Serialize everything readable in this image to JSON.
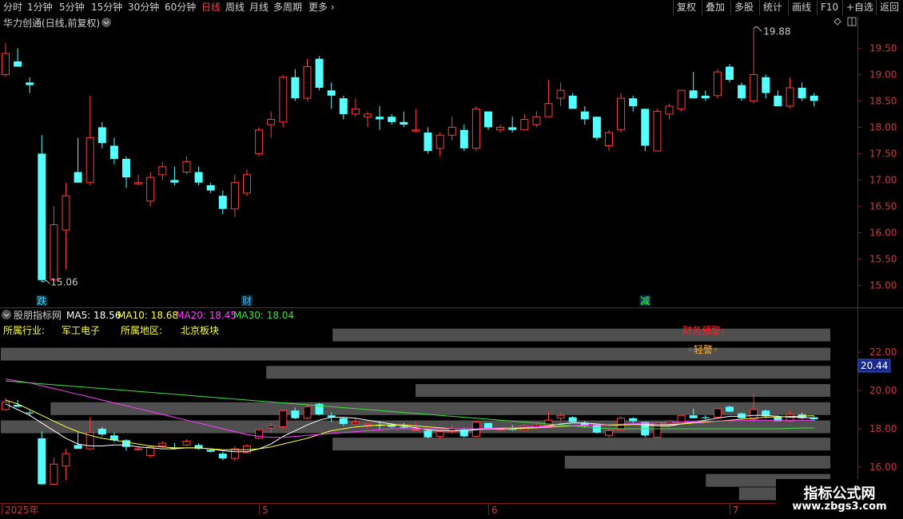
{
  "toolbar": {
    "left": [
      {
        "label": "分时",
        "active": false
      },
      {
        "label": "1分钟",
        "active": false
      },
      {
        "label": "5分钟",
        "active": false
      },
      {
        "label": "15分钟",
        "active": false
      },
      {
        "label": "30分钟",
        "active": false
      },
      {
        "label": "60分钟",
        "active": false
      },
      {
        "label": "日线",
        "active": true
      },
      {
        "label": "周线",
        "active": false
      },
      {
        "label": "月线",
        "active": false
      },
      {
        "label": "多周期",
        "active": false
      },
      {
        "label": "更多",
        "active": false
      }
    ],
    "right": [
      "复权",
      "叠加",
      "多股",
      "统计",
      "画线",
      "F10",
      "+自选",
      "返回"
    ]
  },
  "main_header": {
    "title": "华力创通(日线,前复权)"
  },
  "indicator_header": {
    "name": "股朋指标网",
    "ma5": "MA5: 18.56",
    "ma10": "MA10: 18.68",
    "ma20": "MA20: 18.45",
    "ma30": "MA30: 18.04"
  },
  "info": {
    "industry_label": "所属行业:",
    "industry": "军工电子",
    "region_label": "所属地区:",
    "region": "北京板块",
    "warning_title": "财务预警:",
    "warning_level": "◦轻警◦"
  },
  "markers": [
    {
      "text": "跌",
      "index": 3,
      "color": "#40e0ff"
    },
    {
      "text": "财",
      "index": 20,
      "color": "#40b0ff"
    },
    {
      "text": "减",
      "index": 53,
      "color": "#40ff60"
    }
  ],
  "date_labels": [
    {
      "text": "2025年",
      "index": 0
    },
    {
      "text": "5",
      "index": 21
    },
    {
      "text": "6",
      "index": 40
    },
    {
      "text": "7",
      "index": 60
    }
  ],
  "price_tag": "20.44",
  "watermark": {
    "line1": "指标公式网",
    "line2": "www.zbgs3.com"
  },
  "chart_data": {
    "type": "candlestick",
    "main_axis": {
      "ylim": [
        14.9,
        19.9
      ],
      "ticks": [
        "19.50",
        "19.00",
        "18.50",
        "18.00",
        "17.50",
        "17.00",
        "16.50",
        "16.00",
        "15.50",
        "15.00"
      ]
    },
    "sub_axis": {
      "ylim": [
        14.2,
        23.8
      ],
      "ticks": [
        "22.00",
        "20.00",
        "18.00",
        "16.00"
      ]
    },
    "max_label": "19.88",
    "min_label": "15.06",
    "candles": [
      {
        "o": 19.0,
        "h": 19.6,
        "l": 18.95,
        "c": 19.4
      },
      {
        "o": 19.25,
        "h": 19.5,
        "l": 19.15,
        "c": 19.15
      },
      {
        "o": 18.85,
        "h": 18.95,
        "l": 18.65,
        "c": 18.8
      },
      {
        "o": 17.5,
        "h": 17.85,
        "l": 15.06,
        "c": 15.1
      },
      {
        "o": 15.1,
        "h": 16.5,
        "l": 15.06,
        "c": 16.15
      },
      {
        "o": 16.05,
        "h": 16.95,
        "l": 15.3,
        "c": 16.7
      },
      {
        "o": 17.15,
        "h": 17.8,
        "l": 16.95,
        "c": 16.95
      },
      {
        "o": 16.95,
        "h": 18.6,
        "l": 16.9,
        "c": 17.8
      },
      {
        "o": 18.0,
        "h": 18.1,
        "l": 17.6,
        "c": 17.7
      },
      {
        "o": 17.65,
        "h": 17.8,
        "l": 17.3,
        "c": 17.4
      },
      {
        "o": 17.4,
        "h": 17.45,
        "l": 16.85,
        "c": 17.05
      },
      {
        "o": 16.95,
        "h": 17.1,
        "l": 16.9,
        "c": 16.95
      },
      {
        "o": 16.6,
        "h": 17.15,
        "l": 16.5,
        "c": 17.05
      },
      {
        "o": 17.1,
        "h": 17.35,
        "l": 17.0,
        "c": 17.25
      },
      {
        "o": 17.0,
        "h": 17.25,
        "l": 16.9,
        "c": 16.95
      },
      {
        "o": 17.15,
        "h": 17.45,
        "l": 17.1,
        "c": 17.35
      },
      {
        "o": 17.15,
        "h": 17.25,
        "l": 16.9,
        "c": 16.95
      },
      {
        "o": 16.9,
        "h": 16.95,
        "l": 16.75,
        "c": 16.8
      },
      {
        "o": 16.7,
        "h": 16.8,
        "l": 16.35,
        "c": 16.45
      },
      {
        "o": 16.45,
        "h": 17.1,
        "l": 16.3,
        "c": 16.95
      },
      {
        "o": 16.75,
        "h": 17.2,
        "l": 16.7,
        "c": 17.1
      },
      {
        "o": 17.5,
        "h": 18.0,
        "l": 17.45,
        "c": 17.95
      },
      {
        "o": 18.05,
        "h": 18.3,
        "l": 17.8,
        "c": 18.15
      },
      {
        "o": 18.1,
        "h": 19.0,
        "l": 18.0,
        "c": 18.95
      },
      {
        "o": 18.95,
        "h": 19.1,
        "l": 18.5,
        "c": 18.55
      },
      {
        "o": 18.55,
        "h": 19.3,
        "l": 18.5,
        "c": 19.15
      },
      {
        "o": 19.3,
        "h": 19.35,
        "l": 18.7,
        "c": 18.75
      },
      {
        "o": 18.7,
        "h": 18.85,
        "l": 18.35,
        "c": 18.6
      },
      {
        "o": 18.55,
        "h": 18.6,
        "l": 18.15,
        "c": 18.25
      },
      {
        "o": 18.25,
        "h": 18.55,
        "l": 18.2,
        "c": 18.35
      },
      {
        "o": 18.2,
        "h": 18.3,
        "l": 18.0,
        "c": 18.25
      },
      {
        "o": 18.2,
        "h": 18.4,
        "l": 17.95,
        "c": 18.15
      },
      {
        "o": 18.2,
        "h": 18.25,
        "l": 18.05,
        "c": 18.1
      },
      {
        "o": 18.1,
        "h": 18.3,
        "l": 18.0,
        "c": 18.05
      },
      {
        "o": 17.95,
        "h": 18.35,
        "l": 17.9,
        "c": 17.95
      },
      {
        "o": 17.9,
        "h": 18.0,
        "l": 17.5,
        "c": 17.55
      },
      {
        "o": 17.6,
        "h": 17.9,
        "l": 17.45,
        "c": 17.85
      },
      {
        "o": 17.85,
        "h": 18.2,
        "l": 17.75,
        "c": 18.0
      },
      {
        "o": 17.95,
        "h": 18.05,
        "l": 17.55,
        "c": 17.6
      },
      {
        "o": 17.6,
        "h": 18.4,
        "l": 17.55,
        "c": 18.35
      },
      {
        "o": 18.3,
        "h": 18.3,
        "l": 17.95,
        "c": 18.0
      },
      {
        "o": 17.95,
        "h": 18.05,
        "l": 17.9,
        "c": 18.0
      },
      {
        "o": 18.0,
        "h": 18.2,
        "l": 17.9,
        "c": 17.95
      },
      {
        "o": 17.95,
        "h": 18.25,
        "l": 17.95,
        "c": 18.15
      },
      {
        "o": 18.05,
        "h": 18.3,
        "l": 18.0,
        "c": 18.2
      },
      {
        "o": 18.2,
        "h": 18.9,
        "l": 18.2,
        "c": 18.45
      },
      {
        "o": 18.55,
        "h": 18.85,
        "l": 18.4,
        "c": 18.7
      },
      {
        "o": 18.6,
        "h": 18.65,
        "l": 18.35,
        "c": 18.35
      },
      {
        "o": 18.3,
        "h": 18.4,
        "l": 18.05,
        "c": 18.15
      },
      {
        "o": 18.2,
        "h": 18.2,
        "l": 17.75,
        "c": 17.8
      },
      {
        "o": 17.65,
        "h": 17.95,
        "l": 17.55,
        "c": 17.9
      },
      {
        "o": 17.95,
        "h": 18.65,
        "l": 17.9,
        "c": 18.55
      },
      {
        "o": 18.55,
        "h": 18.6,
        "l": 18.3,
        "c": 18.4
      },
      {
        "o": 18.35,
        "h": 18.35,
        "l": 17.55,
        "c": 17.65
      },
      {
        "o": 17.55,
        "h": 18.35,
        "l": 17.55,
        "c": 18.3
      },
      {
        "o": 18.25,
        "h": 18.45,
        "l": 18.15,
        "c": 18.4
      },
      {
        "o": 18.35,
        "h": 18.7,
        "l": 18.3,
        "c": 18.7
      },
      {
        "o": 18.7,
        "h": 19.05,
        "l": 18.55,
        "c": 18.55
      },
      {
        "o": 18.6,
        "h": 18.7,
        "l": 18.5,
        "c": 18.55
      },
      {
        "o": 18.6,
        "h": 19.1,
        "l": 18.55,
        "c": 19.05
      },
      {
        "o": 19.15,
        "h": 19.2,
        "l": 18.85,
        "c": 18.9
      },
      {
        "o": 18.8,
        "h": 18.85,
        "l": 18.5,
        "c": 18.55
      },
      {
        "o": 18.5,
        "h": 19.88,
        "l": 18.45,
        "c": 19.0
      },
      {
        "o": 18.95,
        "h": 19.0,
        "l": 18.55,
        "c": 18.65
      },
      {
        "o": 18.6,
        "h": 18.7,
        "l": 18.4,
        "c": 18.4
      },
      {
        "o": 18.4,
        "h": 18.95,
        "l": 18.35,
        "c": 18.75
      },
      {
        "o": 18.75,
        "h": 18.85,
        "l": 18.5,
        "c": 18.55
      },
      {
        "o": 18.6,
        "h": 18.65,
        "l": 18.4,
        "c": 18.5
      }
    ],
    "sub_ma": {
      "white": [
        19.3,
        19.0,
        18.7,
        18.3,
        17.9,
        17.5,
        17.2,
        17.1,
        17.1,
        17.15,
        17.15,
        17.05,
        17.0,
        16.95,
        16.95,
        17.0,
        17.0,
        16.95,
        16.85,
        16.8,
        16.8,
        16.95,
        17.2,
        17.6,
        17.9,
        18.2,
        18.45,
        18.6,
        18.6,
        18.55,
        18.45,
        18.35,
        18.25,
        18.15,
        18.05,
        17.95,
        17.9,
        17.9,
        17.9,
        17.95,
        18.0,
        18.0,
        18.0,
        18.05,
        18.1,
        18.15,
        18.25,
        18.3,
        18.3,
        18.25,
        18.2,
        18.2,
        18.25,
        18.2,
        18.15,
        18.15,
        18.25,
        18.35,
        18.45,
        18.55,
        18.65,
        18.65,
        18.7,
        18.7,
        18.65,
        18.6,
        18.6,
        18.55
      ],
      "yellow": [
        19.5,
        19.3,
        19.0,
        18.7,
        18.4,
        18.1,
        17.85,
        17.65,
        17.5,
        17.4,
        17.3,
        17.2,
        17.1,
        17.05,
        17.0,
        17.0,
        17.0,
        16.95,
        16.9,
        16.9,
        16.9,
        16.95,
        17.05,
        17.2,
        17.35,
        17.5,
        17.7,
        17.9,
        18.0,
        18.1,
        18.15,
        18.2,
        18.2,
        18.2,
        18.15,
        18.1,
        18.05,
        18.0,
        18.0,
        17.98,
        17.98,
        17.98,
        18.0,
        18.02,
        18.05,
        18.08,
        18.12,
        18.15,
        18.18,
        18.2,
        18.2,
        18.2,
        18.22,
        18.22,
        18.22,
        18.22,
        18.25,
        18.3,
        18.35,
        18.4,
        18.45,
        18.5,
        18.55,
        18.6,
        18.62,
        18.64,
        18.66,
        18.68
      ],
      "magenta": [
        20.6,
        20.5,
        20.4,
        20.25,
        20.1,
        19.95,
        19.8,
        19.65,
        19.5,
        19.35,
        19.2,
        19.05,
        18.9,
        18.75,
        18.6,
        18.45,
        18.3,
        18.15,
        18.0,
        17.85,
        17.7,
        17.6,
        17.55,
        17.55,
        17.6,
        17.65,
        17.7,
        17.75,
        17.8,
        17.85,
        17.9,
        17.95,
        18.0,
        18.0,
        18.0,
        18.0,
        18.0,
        18.0,
        18.0,
        18.0,
        18.02,
        18.04,
        18.06,
        18.08,
        18.1,
        18.12,
        18.14,
        18.16,
        18.18,
        18.2,
        18.22,
        18.24,
        18.26,
        18.28,
        18.3,
        18.32,
        18.34,
        18.36,
        18.38,
        18.4,
        18.42,
        18.43,
        18.44,
        18.45,
        18.45,
        18.45,
        18.45,
        18.45
      ],
      "green": [
        20.5,
        20.45,
        20.4,
        20.35,
        20.3,
        20.25,
        20.2,
        20.15,
        20.1,
        20.05,
        20.0,
        19.95,
        19.9,
        19.85,
        19.8,
        19.75,
        19.7,
        19.65,
        19.6,
        19.55,
        19.5,
        19.45,
        19.4,
        19.35,
        19.3,
        19.25,
        19.2,
        19.15,
        19.1,
        19.05,
        19.0,
        18.95,
        18.9,
        18.85,
        18.8,
        18.75,
        18.7,
        18.65,
        18.6,
        18.55,
        18.5,
        18.45,
        18.4,
        18.35,
        18.3,
        18.25,
        18.2,
        18.15,
        18.1,
        18.05,
        18.0,
        18.0,
        18.0,
        18.0,
        18.0,
        18.0,
        18.0,
        18.0,
        18.0,
        18.0,
        18.0,
        18.0,
        18.0,
        18.0,
        18.0,
        18.02,
        18.04,
        18.04
      ]
    },
    "volume_profile": [
      {
        "price": 22.9,
        "length": 0.6
      },
      {
        "price": 21.9,
        "length": 1.0
      },
      {
        "price": 20.95,
        "length": 0.68
      },
      {
        "price": 20.0,
        "length": 0.5
      },
      {
        "price": 19.05,
        "length": 0.94
      },
      {
        "price": 18.1,
        "length": 1.0
      },
      {
        "price": 17.2,
        "length": 0.6
      },
      {
        "price": 16.25,
        "length": 0.32
      },
      {
        "price": 15.3,
        "length": 0.15
      },
      {
        "price": 14.6,
        "length": 0.11
      }
    ]
  }
}
